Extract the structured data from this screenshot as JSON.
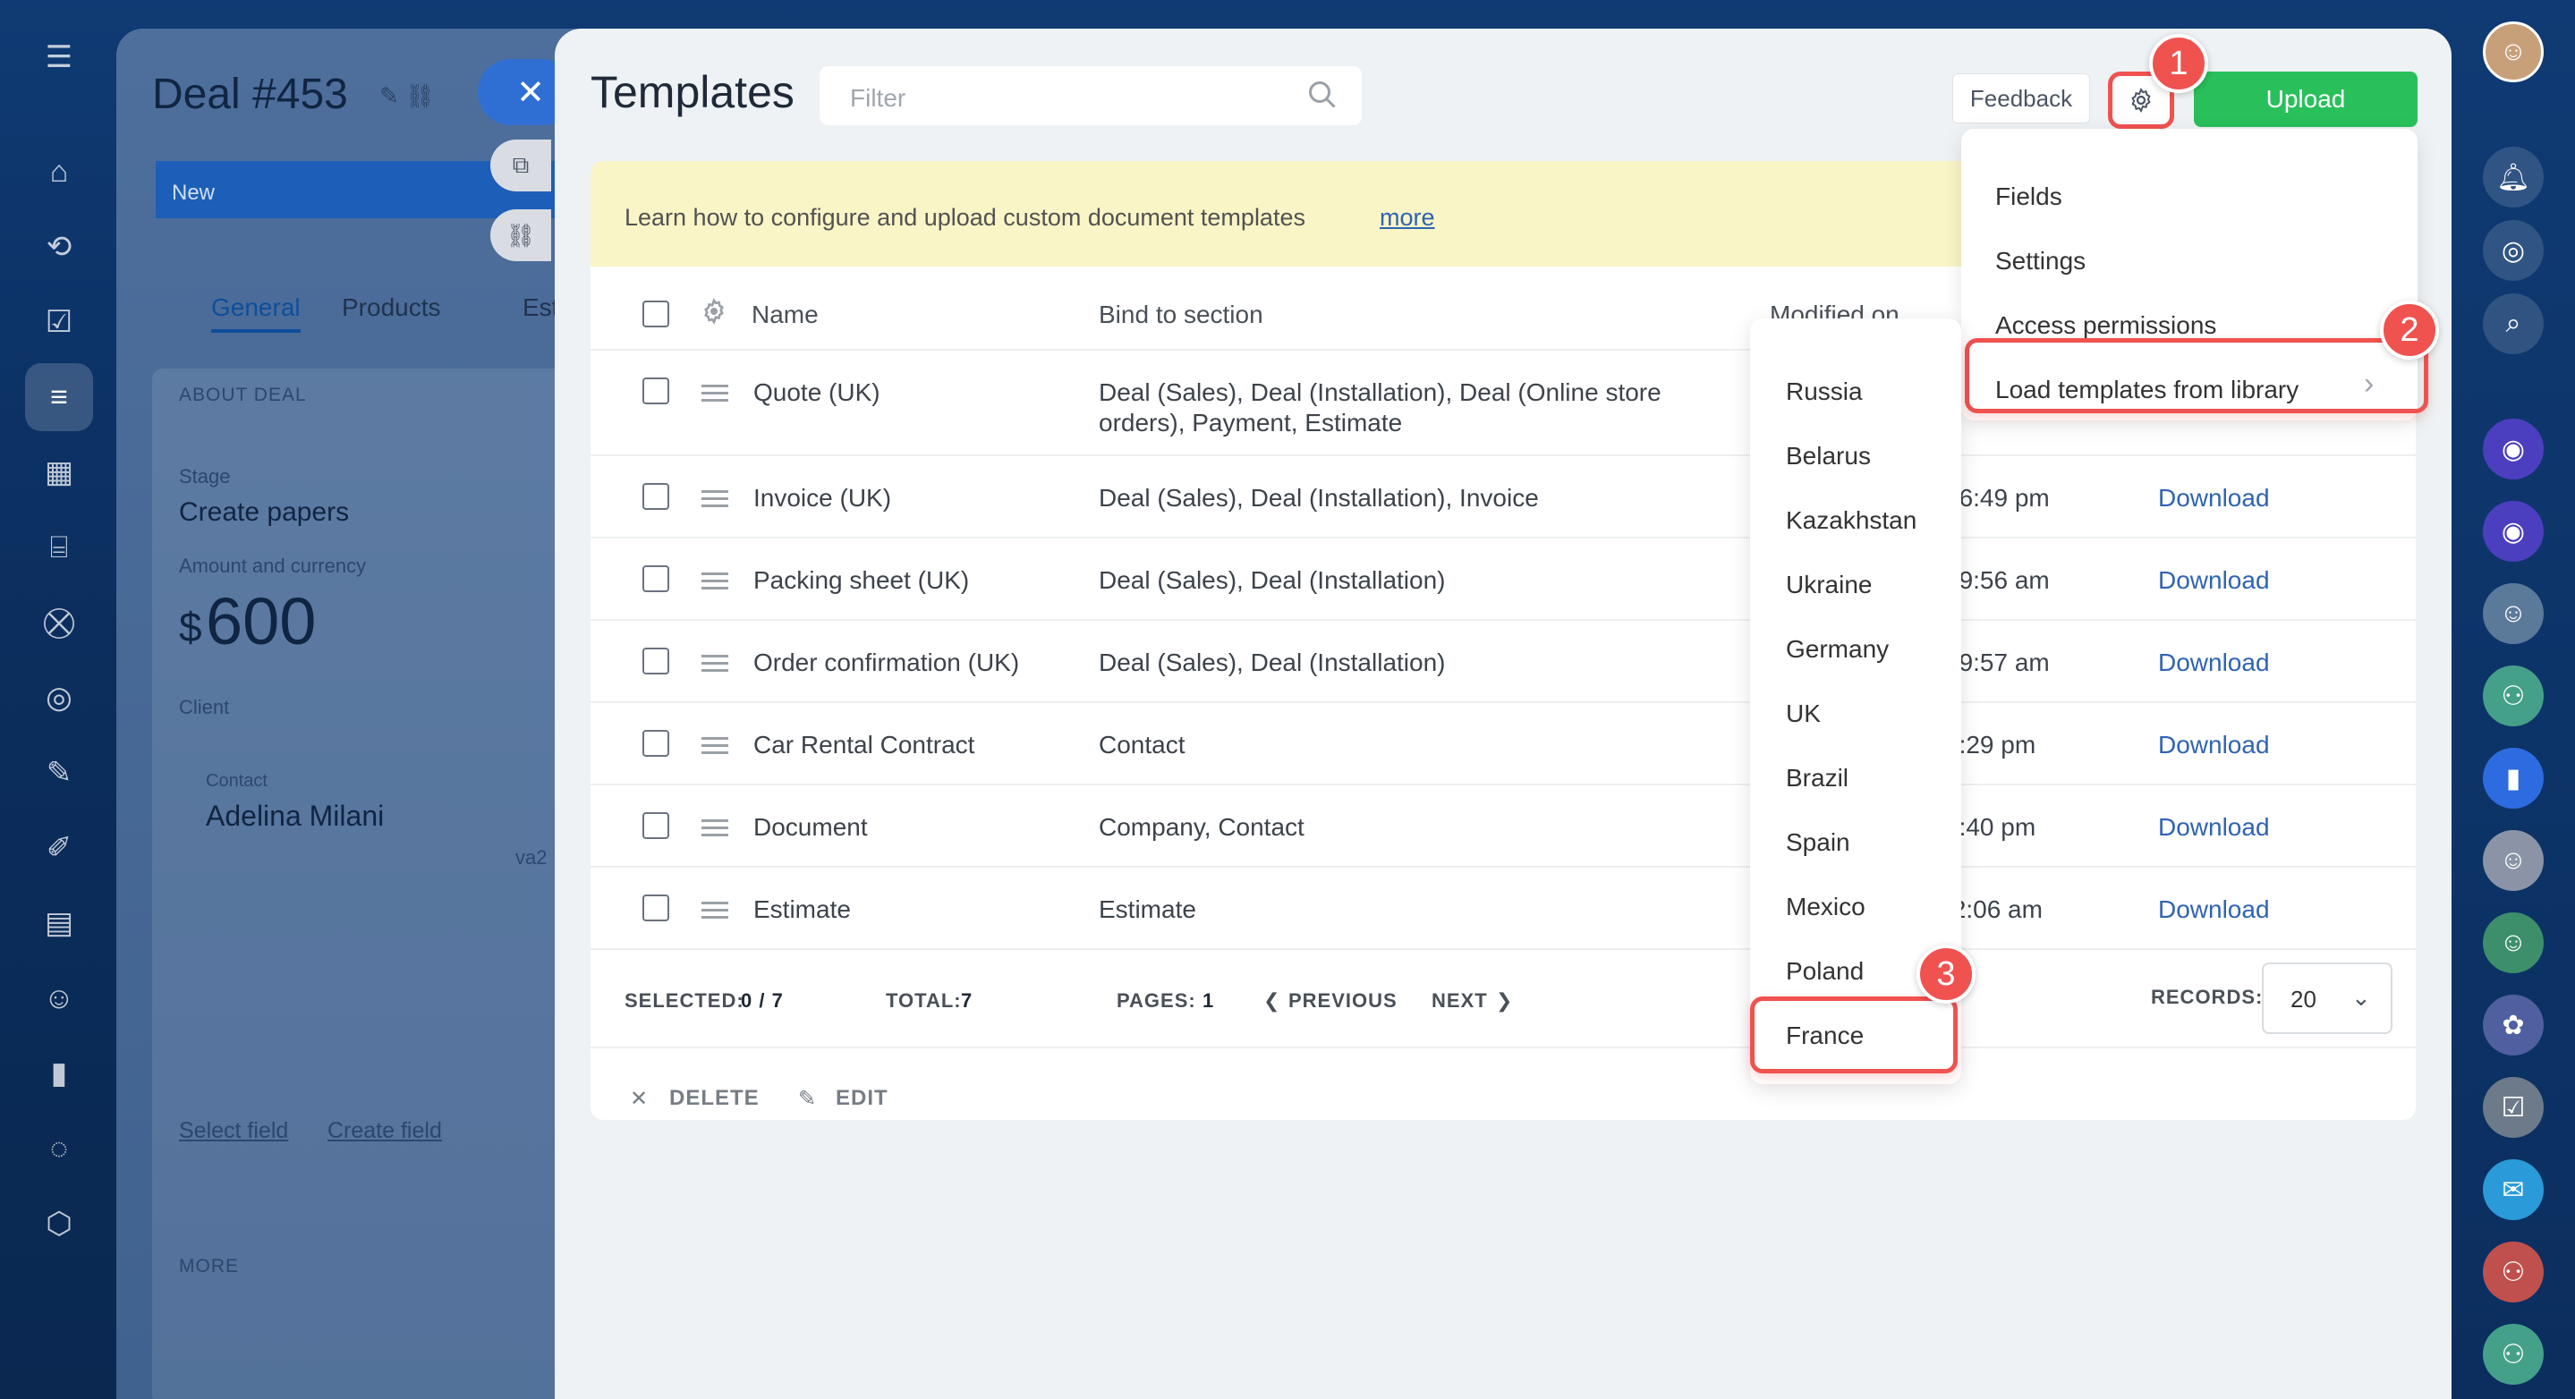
{
  "deal": {
    "title": "Deal #453",
    "stage_bar": "New",
    "tabs": [
      "General",
      "Products",
      "Est"
    ],
    "section": "ABOUT DEAL",
    "stage_label": "Stage",
    "stage_value": "Create papers",
    "amount_label": "Amount and currency",
    "amount_currency": "$",
    "amount_value": "600",
    "client_label": "Client",
    "contact_label": "Contact",
    "contact_name": "Adelina Milani",
    "side_text": "va2",
    "select_field": "Select field",
    "create_field": "Create field",
    "more": "MORE"
  },
  "modal": {
    "title": "Templates",
    "filter_placeholder": "Filter",
    "feedback": "Feedback",
    "upload": "Upload",
    "banner_text": "Learn how to configure and upload custom document templates",
    "banner_link": "more"
  },
  "table": {
    "headers": {
      "name": "Name",
      "bind": "Bind to section",
      "modified": "Modified on"
    },
    "rows": [
      {
        "name": "Quote (UK)",
        "bind": "Deal (Sales), Deal (Installation), Deal (Online store orders), Payment, Estimate",
        "modified": "",
        "action": ""
      },
      {
        "name": "Invoice (UK)",
        "bind": "Deal (Sales), Deal (Installation), Invoice",
        "modified": "56:49 pm",
        "action": "Download"
      },
      {
        "name": "Packing sheet (UK)",
        "bind": "Deal (Sales), Deal (Installation)",
        "modified": "29:56 am",
        "action": "Download"
      },
      {
        "name": "Order confirmation (UK)",
        "bind": "Deal (Sales), Deal (Installation)",
        "modified": "29:57 am",
        "action": "Download"
      },
      {
        "name": "Car Rental Contract",
        "bind": "Contact",
        "modified": "4:29 pm",
        "action": "Download"
      },
      {
        "name": "Document",
        "bind": "Company, Contact",
        "modified": "4:40 pm",
        "action": "Download"
      },
      {
        "name": "Estimate",
        "bind": "Estimate",
        "modified": ":2:06 am",
        "action": "Download"
      }
    ]
  },
  "pager": {
    "selected_label": "SELECTED:",
    "selected_value": "0 / 7",
    "total_label": "TOTAL:",
    "total_value": "7",
    "pages_label": "PAGES:",
    "pages_value": "1",
    "previous": "PREVIOUS",
    "next": "NEXT",
    "records_label": "RECORDS:",
    "records_value": "20"
  },
  "footer": {
    "delete": "DELETE",
    "edit": "EDIT"
  },
  "gear_menu": {
    "items": [
      "Fields",
      "Settings",
      "Access permissions",
      "Load templates from library"
    ]
  },
  "country_menu": {
    "items": [
      "Russia",
      "Belarus",
      "Kazakhstan",
      "Ukraine",
      "Germany",
      "UK",
      "Brazil",
      "Spain",
      "Mexico",
      "Poland",
      "France"
    ]
  },
  "badges": [
    "1",
    "2",
    "3"
  ],
  "colors": {
    "accent_red": "#f0524f",
    "upload_green": "#29c05b",
    "link_blue": "#2f63b3",
    "banner_yellow": "#f9f5c6"
  }
}
